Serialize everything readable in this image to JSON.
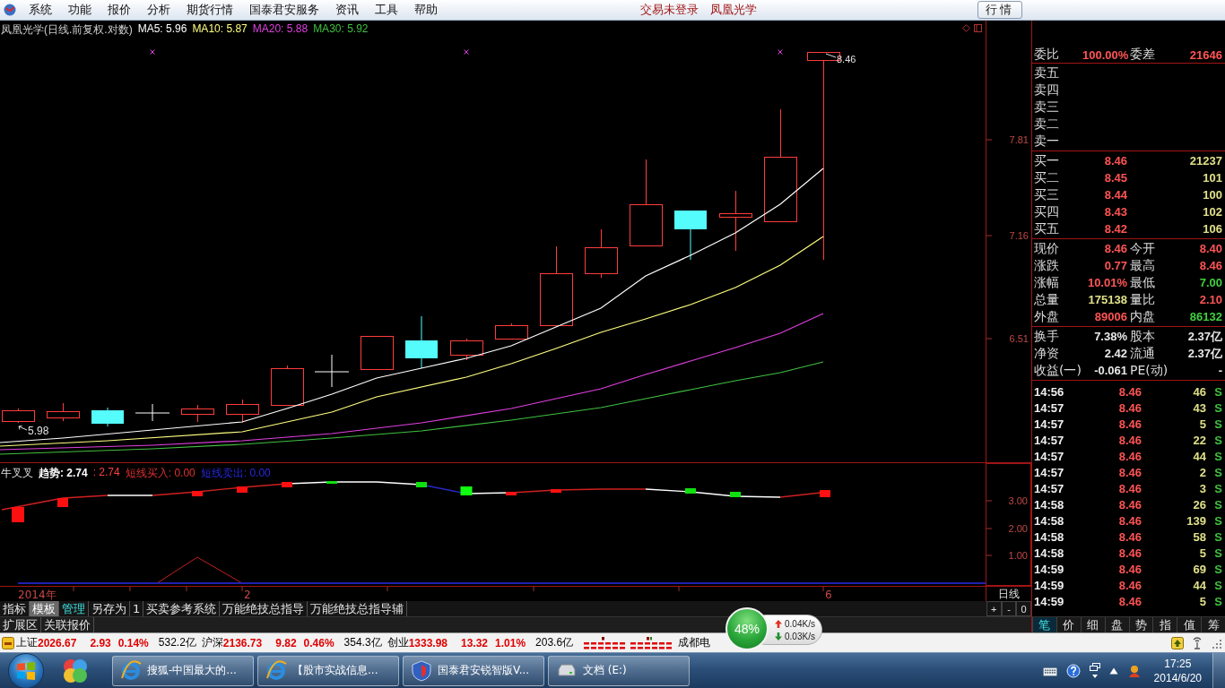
{
  "menu_bar": {
    "items": [
      "系统",
      "功能",
      "报价",
      "分析",
      "期货行情",
      "国泰君安服务",
      "资讯",
      "工具",
      "帮助"
    ],
    "login_status": "交易未登录",
    "stock_name": "凤凰光学",
    "quote_button": "行情"
  },
  "main_chart": {
    "title": "凤凰光学(日线.前复权.对数)",
    "legend": [
      {
        "label": "MA5: 5.96",
        "color": "#ffffff"
      },
      {
        "label": "MA10: 5.87",
        "color": "#ffff80"
      },
      {
        "label": "MA20: 5.88",
        "color": "#e040e0"
      },
      {
        "label": "MA30: 5.92",
        "color": "#40c040"
      }
    ],
    "high_label": "8.46",
    "low_label": "5.98",
    "price_axis": [
      "7.81",
      "7.16",
      "6.51"
    ]
  },
  "indicator": {
    "name": "牛叉叉",
    "legend": [
      {
        "label": "趋势: 2.74",
        "color": "#ffffff"
      },
      {
        "label": ": 2.74",
        "color": "#ff4040"
      },
      {
        "label": "短线买入: 0.00",
        "color": "#e03030"
      },
      {
        "label": "短线卖出: 0.00",
        "color": "#2828e0"
      }
    ],
    "axis": [
      "3.00",
      "2.00",
      "1.00"
    ]
  },
  "date_axis": [
    "2014年",
    "2",
    "6"
  ],
  "period": {
    "label": "日线",
    "zoom_buttons": [
      "+",
      "-",
      "0"
    ]
  },
  "indicator_tabs": [
    {
      "label": "指标",
      "kind": "plain",
      "selected": false
    },
    {
      "label": "模板",
      "kind": "plain",
      "selected": true
    },
    {
      "label": "管理",
      "kind": "accent",
      "selected": false
    },
    {
      "label": "另存为",
      "kind": "plain",
      "selected": false
    },
    {
      "label": "1",
      "kind": "plain",
      "selected": false
    },
    {
      "label": "买卖参考系统",
      "kind": "plain",
      "selected": false
    },
    {
      "label": "万能绝技总指导",
      "kind": "plain",
      "selected": false
    },
    {
      "label": "万能绝技总指导辅",
      "kind": "plain",
      "selected": false
    }
  ],
  "extension_bar": [
    "扩展区",
    "关联报价"
  ],
  "quote_panel": {
    "summary": [
      {
        "label": "委比",
        "value": "100.00%"
      },
      {
        "label": "委差",
        "value": "21646"
      }
    ],
    "asks": [
      "卖五",
      "卖四",
      "卖三",
      "卖二",
      "卖一"
    ],
    "bids": [
      {
        "label": "买一",
        "price": "8.46",
        "volume": "21237"
      },
      {
        "label": "买二",
        "price": "8.45",
        "volume": "101"
      },
      {
        "label": "买三",
        "price": "8.44",
        "volume": "100"
      },
      {
        "label": "买四",
        "price": "8.43",
        "volume": "102"
      },
      {
        "label": "买五",
        "price": "8.42",
        "volume": "106"
      }
    ],
    "stats": [
      {
        "label": "现价",
        "value": "8.46",
        "color": "#ff5454"
      },
      {
        "label": "今开",
        "value": "8.40",
        "color": "#ff5454"
      },
      {
        "label": "涨跌",
        "value": "0.77",
        "color": "#ff5454"
      },
      {
        "label": "最高",
        "value": "8.46",
        "color": "#ff5454"
      },
      {
        "label": "涨幅",
        "value": "10.01%",
        "color": "#ff5454"
      },
      {
        "label": "最低",
        "value": "7.00",
        "color": "#40d040"
      },
      {
        "label": "总量",
        "value": "175138",
        "color": "#e0e088"
      },
      {
        "label": "量比",
        "value": "2.10",
        "color": "#ff5454"
      },
      {
        "label": "外盘",
        "value": "89006",
        "color": "#ff5454"
      },
      {
        "label": "内盘",
        "value": "86132",
        "color": "#40d040"
      }
    ],
    "fundamentals": [
      {
        "label": "换手",
        "value": "7.38%"
      },
      {
        "label": "股本",
        "value": "2.37亿"
      },
      {
        "label": "净资",
        "value": "2.42"
      },
      {
        "label": "流通",
        "value": "2.37亿"
      },
      {
        "label": "收益(一)",
        "value": "-0.061"
      },
      {
        "label": "PE(动)",
        "value": "-"
      }
    ],
    "ticks": [
      {
        "time": "14:56",
        "price": "8.46",
        "volume": "46",
        "side": "S"
      },
      {
        "time": "14:57",
        "price": "8.46",
        "volume": "43",
        "side": "S"
      },
      {
        "time": "14:57",
        "price": "8.46",
        "volume": "5",
        "side": "S"
      },
      {
        "time": "14:57",
        "price": "8.46",
        "volume": "22",
        "side": "S"
      },
      {
        "time": "14:57",
        "price": "8.46",
        "volume": "44",
        "side": "S"
      },
      {
        "time": "14:57",
        "price": "8.46",
        "volume": "2",
        "side": "S"
      },
      {
        "time": "14:57",
        "price": "8.46",
        "volume": "3",
        "side": "S"
      },
      {
        "time": "14:58",
        "price": "8.46",
        "volume": "26",
        "side": "S"
      },
      {
        "time": "14:58",
        "price": "8.46",
        "volume": "139",
        "side": "S"
      },
      {
        "time": "14:58",
        "price": "8.46",
        "volume": "58",
        "side": "S"
      },
      {
        "time": "14:58",
        "price": "8.46",
        "volume": "5",
        "side": "S"
      },
      {
        "time": "14:59",
        "price": "8.46",
        "volume": "69",
        "side": "S"
      },
      {
        "time": "14:59",
        "price": "8.46",
        "volume": "44",
        "side": "S"
      },
      {
        "time": "14:59",
        "price": "8.46",
        "volume": "5",
        "side": "S"
      }
    ],
    "tabs": [
      {
        "label": "笔",
        "selected": true
      },
      {
        "label": "价",
        "selected": false
      },
      {
        "label": "细",
        "selected": false
      },
      {
        "label": "盘",
        "selected": false
      },
      {
        "label": "势",
        "selected": false
      },
      {
        "label": "指",
        "selected": false
      },
      {
        "label": "值",
        "selected": false
      },
      {
        "label": "筹",
        "selected": false
      }
    ]
  },
  "status_bar": {
    "indices": [
      {
        "name": "上证",
        "value": "2026.67",
        "change": "2.93",
        "percent": "0.14%",
        "amount": "532.2亿"
      },
      {
        "name": "沪深",
        "value": "2136.73",
        "change": "9.82",
        "percent": "0.46%",
        "amount": "354.3亿"
      },
      {
        "name": "创业",
        "value": "1333.98",
        "change": "13.32",
        "percent": "1.01%",
        "amount": "203.6亿"
      }
    ],
    "isp": "成都电"
  },
  "speed_widget": {
    "percent": "48%",
    "upload": "0.04K/s",
    "download": "0.03K/s"
  },
  "taskbar": {
    "tasks": [
      {
        "label": "搜狐-中国最大的...",
        "kind": "browser"
      },
      {
        "label": "【股市实战信息...",
        "kind": "browser"
      },
      {
        "label": "国泰君安锐智版V...",
        "kind": "shield"
      },
      {
        "label": "文档 (E:)",
        "kind": "drive"
      }
    ],
    "time": "17:25",
    "date": "2014/6/20"
  }
}
